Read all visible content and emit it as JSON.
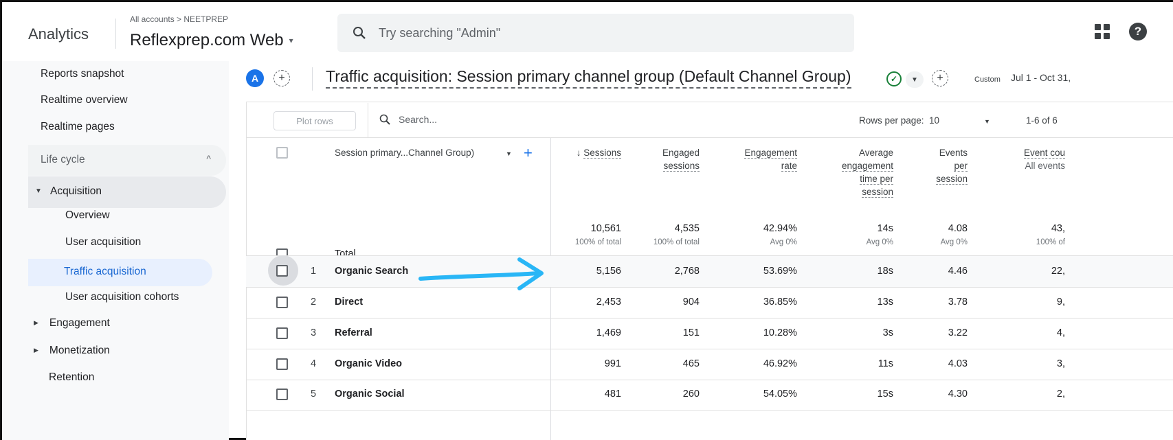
{
  "header": {
    "brand": "Analytics",
    "breadcrumb": "All accounts > NEETPREP",
    "property": "Reflexprep.com Web",
    "property_caret": "▾",
    "search_placeholder": "Try searching \"Admin\"",
    "help_glyph": "?"
  },
  "sidebar": {
    "top_items": [
      "Reports snapshot",
      "Realtime overview",
      "Realtime pages"
    ],
    "lifecycle_label": "Life cycle",
    "acquisition_label": "Acquisition",
    "acquisition_items": [
      "Overview",
      "User acquisition",
      "Traffic acquisition",
      "User acquisition cohorts"
    ],
    "active_item": "Traffic acquisition",
    "groups": [
      "Engagement",
      "Monetization"
    ],
    "retention": "Retention"
  },
  "report": {
    "avatar_letter": "A",
    "title": "Traffic acquisition: Session primary channel group (Default Channel Group)",
    "check_glyph": "✓",
    "date_mode": "Custom",
    "date_range": "Jul 1 - Oct 31,"
  },
  "table": {
    "plot_rows_label": "Plot rows",
    "search_placeholder": "Search...",
    "rows_per_page_label": "Rows per page:",
    "rows_per_page_value": "10",
    "page_info": "1-6 of 6",
    "dimension_header": "Session primary...Channel Group)",
    "columns": {
      "sessions": "Sessions",
      "sort_glyph": "↓",
      "engaged_1": "Engaged",
      "engaged_2": "sessions",
      "engrate_1": "Engagement",
      "engrate_2": "rate",
      "avgeng_1": "Average",
      "avgeng_2": "engagement",
      "avgeng_3": "time per",
      "avgeng_4": "session",
      "events_1": "Events",
      "events_2": "per",
      "events_3": "session",
      "eventcount_1": "Event cou",
      "eventcount_2": "All events"
    },
    "total": {
      "label": "Total",
      "sessions": "10,561",
      "sessions_sub": "100% of total",
      "engaged": "4,535",
      "engaged_sub": "100% of total",
      "rate": "42.94%",
      "rate_sub": "Avg 0%",
      "avg_time": "14s",
      "avg_time_sub": "Avg 0%",
      "events_per": "4.08",
      "events_per_sub": "Avg 0%",
      "event_count": "43,",
      "event_count_sub": "100% of"
    },
    "rows": [
      {
        "num": "1",
        "name": "Organic Search",
        "sessions": "5,156",
        "engaged": "2,768",
        "rate": "53.69%",
        "avg_time": "18s",
        "events_per": "4.46",
        "event_count": "22,"
      },
      {
        "num": "2",
        "name": "Direct",
        "sessions": "2,453",
        "engaged": "904",
        "rate": "36.85%",
        "avg_time": "13s",
        "events_per": "3.78",
        "event_count": "9,"
      },
      {
        "num": "3",
        "name": "Referral",
        "sessions": "1,469",
        "engaged": "151",
        "rate": "10.28%",
        "avg_time": "3s",
        "events_per": "3.22",
        "event_count": "4,"
      },
      {
        "num": "4",
        "name": "Organic Video",
        "sessions": "991",
        "engaged": "465",
        "rate": "46.92%",
        "avg_time": "11s",
        "events_per": "4.03",
        "event_count": "3,"
      },
      {
        "num": "5",
        "name": "Organic Social",
        "sessions": "481",
        "engaged": "260",
        "rate": "54.05%",
        "avg_time": "15s",
        "events_per": "4.30",
        "event_count": "2,"
      }
    ]
  },
  "colors": {
    "accent": "#1a73e8",
    "active_nav_bg": "#e8f0fe",
    "annotation_arrow": "#29b6f6"
  }
}
